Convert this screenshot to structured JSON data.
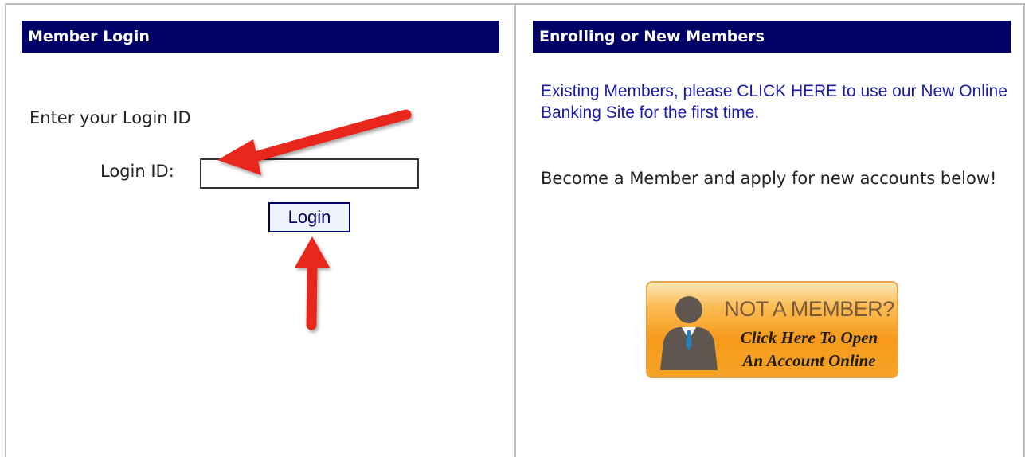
{
  "left_panel": {
    "header": "Member Login",
    "prompt": "Enter your Login ID",
    "login_label": "Login ID:",
    "login_value": "",
    "login_button": "Login"
  },
  "right_panel": {
    "header": "Enrolling or New Members",
    "existing_link": "Existing Members, please CLICK HERE to use our New Online Banking Site for the first time.",
    "become_text": "Become a Member and apply for new accounts below!",
    "cta": {
      "line1": "NOT A MEMBER?",
      "line2": "Click Here To Open",
      "line3": "An Account Online"
    }
  },
  "annotations": {
    "arrow_color": "#e8261f",
    "arrow_count": 2
  },
  "colors": {
    "header_bg": "#000066",
    "link": "#1a1aa6",
    "cta_orange": "#f79a1b"
  }
}
